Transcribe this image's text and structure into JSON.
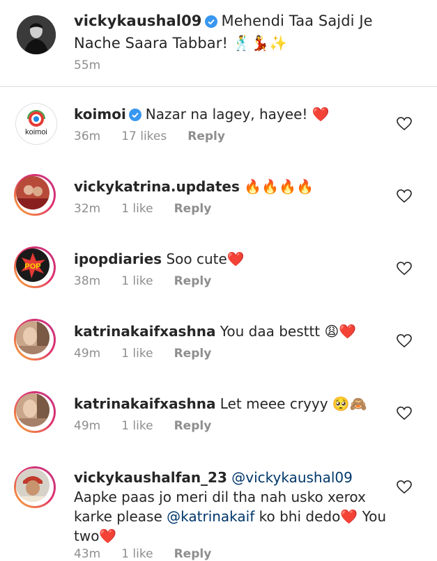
{
  "caption": {
    "username": "vickykaushal09",
    "text": "Mehendi Taa Sajdi Je Nache Saara Tabbar! 🕺💃✨",
    "time": "55m"
  },
  "comments": [
    {
      "username": "koimoi",
      "verified": true,
      "text": "Nazar na lagey, hayee! ❤️",
      "time": "36m",
      "likes": "17 likes",
      "reply": "Reply",
      "avatar_label": "koimoi"
    },
    {
      "username": "vickykatrina.updates",
      "text": "🔥🔥🔥🔥",
      "time": "32m",
      "likes": "1 like",
      "reply": "Reply"
    },
    {
      "username": "ipopdiaries",
      "text": "Soo cute❤️",
      "time": "38m",
      "likes": "1 like",
      "reply": "Reply",
      "avatar_label": "POP"
    },
    {
      "username": "katrinakaifxashna",
      "text": "You daa besttt 😩❤️",
      "time": "49m",
      "likes": "1 like",
      "reply": "Reply"
    },
    {
      "username": "katrinakaifxashna",
      "text": "Let meee cryyy 🥺🙈",
      "time": "49m",
      "likes": "1 like",
      "reply": "Reply"
    },
    {
      "username": "vickykaushalfan_23",
      "mention1": "@vickykaushal09",
      "text_a": "Aapke paas jo meri dil tha nah usko xerox karke please",
      "mention2": "@katrinakaif",
      "text_b": "ko bhi dedo❤️ You two❤️",
      "time": "43m",
      "likes": "1 like",
      "reply": "Reply"
    }
  ],
  "colors": {
    "secondary_text": "#8e8e8e",
    "verified": "#3897f0",
    "mention": "#00376b"
  }
}
